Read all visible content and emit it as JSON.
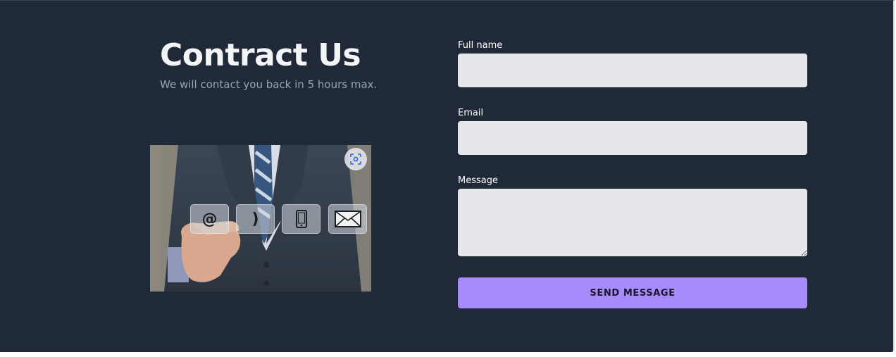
{
  "hero": {
    "title": "Contract Us",
    "subtitle": "We will contact you back in 5 hours max."
  },
  "image": {
    "icons": [
      "lens-icon",
      "at-sign-icon",
      "phone-handset-icon",
      "mobile-phone-icon",
      "envelope-icon"
    ],
    "tiles": [
      "@",
      ")"
    ]
  },
  "form": {
    "full_name_label": "Full name",
    "full_name_value": "",
    "email_label": "Email",
    "email_value": "",
    "message_label": "Message",
    "message_value": "",
    "submit_label": "SEND MESSAGE"
  },
  "colors": {
    "background": "#202938",
    "input_bg": "#e5e7eb",
    "accent": "#a78bfa",
    "title": "#f3f4f6",
    "subtitle": "#9aa3b2"
  }
}
